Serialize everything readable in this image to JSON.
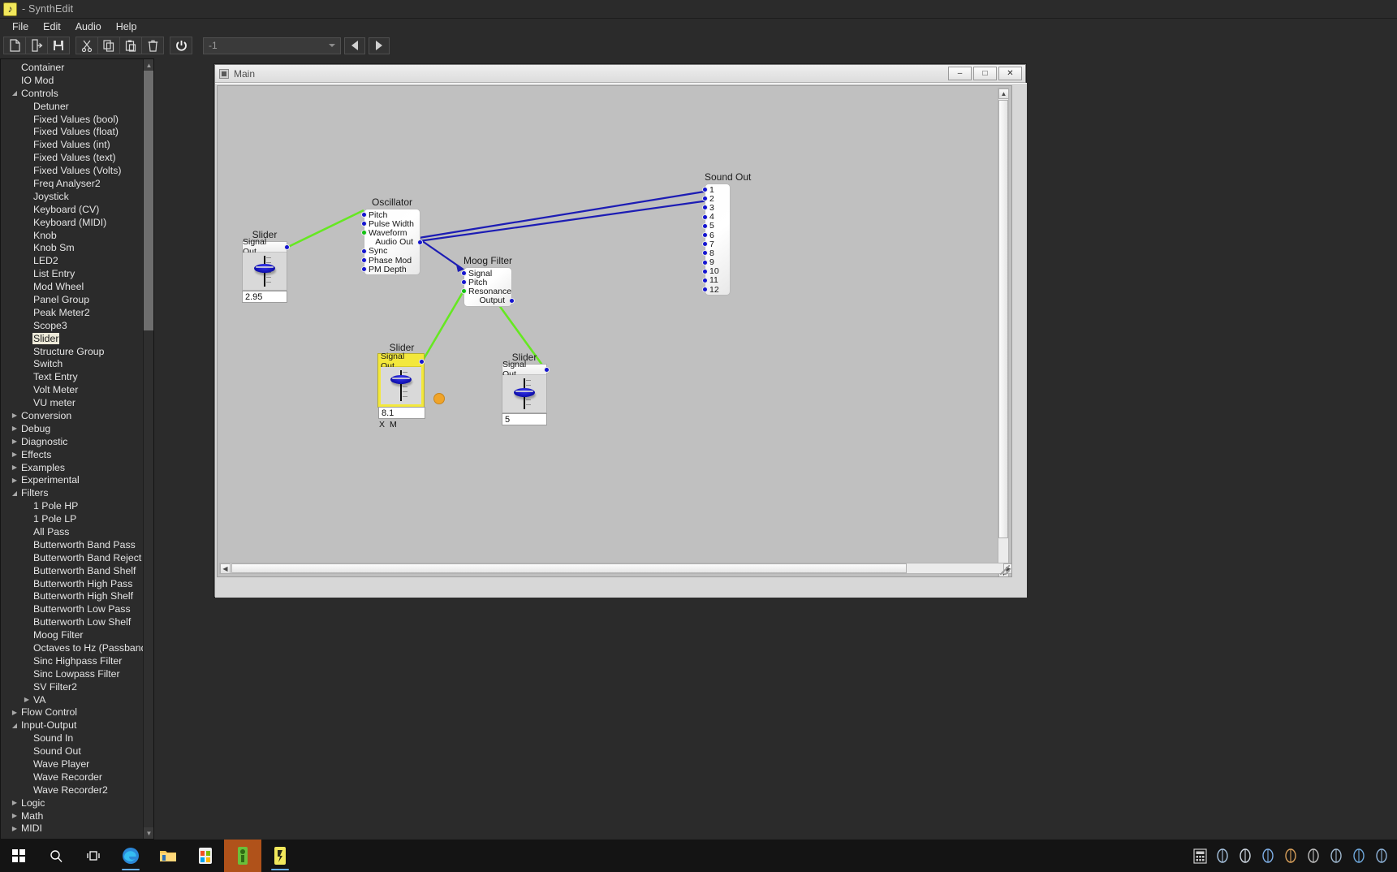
{
  "window": {
    "title": "- SynthEdit",
    "app_icon": "synthedit-icon"
  },
  "menu": {
    "items": [
      {
        "label": "File"
      },
      {
        "label": "Edit"
      },
      {
        "label": "Audio"
      },
      {
        "label": "Help"
      }
    ]
  },
  "toolbar": {
    "buttons": [
      {
        "name": "new-file-button",
        "icon": "page-icon"
      },
      {
        "name": "open-file-button",
        "icon": "open-folder-icon"
      },
      {
        "name": "save-file-button",
        "icon": "floppy-disk-icon"
      },
      {
        "name": "cut-button",
        "icon": "scissors-icon"
      },
      {
        "name": "copy-button",
        "icon": "copy-icon"
      },
      {
        "name": "paste-button",
        "icon": "clipboard-icon"
      },
      {
        "name": "delete-button",
        "icon": "trash-icon"
      },
      {
        "name": "power-button",
        "icon": "power-icon"
      }
    ],
    "preset_combo_value": "-1",
    "prev_label": "◀",
    "next_label": "▶"
  },
  "sidebar": {
    "items": [
      {
        "label": "Container",
        "depth": 0,
        "arrow": "none"
      },
      {
        "label": "IO Mod",
        "depth": 0,
        "arrow": "none"
      },
      {
        "label": "Controls",
        "depth": 0,
        "arrow": "expanded"
      },
      {
        "label": "Detuner",
        "depth": 1,
        "arrow": "none"
      },
      {
        "label": "Fixed Values (bool)",
        "depth": 1,
        "arrow": "none"
      },
      {
        "label": "Fixed Values (float)",
        "depth": 1,
        "arrow": "none"
      },
      {
        "label": "Fixed Values (int)",
        "depth": 1,
        "arrow": "none"
      },
      {
        "label": "Fixed Values (text)",
        "depth": 1,
        "arrow": "none"
      },
      {
        "label": "Fixed Values (Volts)",
        "depth": 1,
        "arrow": "none"
      },
      {
        "label": "Freq Analyser2",
        "depth": 1,
        "arrow": "none"
      },
      {
        "label": "Joystick",
        "depth": 1,
        "arrow": "none"
      },
      {
        "label": "Keyboard (CV)",
        "depth": 1,
        "arrow": "none"
      },
      {
        "label": "Keyboard (MIDI)",
        "depth": 1,
        "arrow": "none"
      },
      {
        "label": "Knob",
        "depth": 1,
        "arrow": "none"
      },
      {
        "label": "Knob Sm",
        "depth": 1,
        "arrow": "none"
      },
      {
        "label": "LED2",
        "depth": 1,
        "arrow": "none"
      },
      {
        "label": "List Entry",
        "depth": 1,
        "arrow": "none"
      },
      {
        "label": "Mod Wheel",
        "depth": 1,
        "arrow": "none"
      },
      {
        "label": "Panel Group",
        "depth": 1,
        "arrow": "none"
      },
      {
        "label": "Peak Meter2",
        "depth": 1,
        "arrow": "none"
      },
      {
        "label": "Scope3",
        "depth": 1,
        "arrow": "none"
      },
      {
        "label": "Slider",
        "depth": 1,
        "arrow": "none",
        "selected": true
      },
      {
        "label": "Structure Group",
        "depth": 1,
        "arrow": "none"
      },
      {
        "label": "Switch",
        "depth": 1,
        "arrow": "none"
      },
      {
        "label": "Text Entry",
        "depth": 1,
        "arrow": "none"
      },
      {
        "label": "Volt Meter",
        "depth": 1,
        "arrow": "none"
      },
      {
        "label": "VU meter",
        "depth": 1,
        "arrow": "none"
      },
      {
        "label": "Conversion",
        "depth": 0,
        "arrow": "collapsed"
      },
      {
        "label": "Debug",
        "depth": 0,
        "arrow": "collapsed"
      },
      {
        "label": "Diagnostic",
        "depth": 0,
        "arrow": "collapsed"
      },
      {
        "label": "Effects",
        "depth": 0,
        "arrow": "collapsed"
      },
      {
        "label": "Examples",
        "depth": 0,
        "arrow": "collapsed"
      },
      {
        "label": "Experimental",
        "depth": 0,
        "arrow": "collapsed"
      },
      {
        "label": "Filters",
        "depth": 0,
        "arrow": "expanded"
      },
      {
        "label": "1 Pole HP",
        "depth": 1,
        "arrow": "none"
      },
      {
        "label": "1 Pole LP",
        "depth": 1,
        "arrow": "none"
      },
      {
        "label": "All Pass",
        "depth": 1,
        "arrow": "none"
      },
      {
        "label": "Butterworth Band Pass",
        "depth": 1,
        "arrow": "none"
      },
      {
        "label": "Butterworth Band Reject",
        "depth": 1,
        "arrow": "none"
      },
      {
        "label": "Butterworth Band Shelf",
        "depth": 1,
        "arrow": "none"
      },
      {
        "label": "Butterworth High Pass",
        "depth": 1,
        "arrow": "none"
      },
      {
        "label": "Butterworth High Shelf",
        "depth": 1,
        "arrow": "none"
      },
      {
        "label": "Butterworth Low Pass",
        "depth": 1,
        "arrow": "none"
      },
      {
        "label": "Butterworth Low Shelf",
        "depth": 1,
        "arrow": "none"
      },
      {
        "label": "Moog Filter",
        "depth": 1,
        "arrow": "none"
      },
      {
        "label": "Octaves to Hz (Passband)",
        "depth": 1,
        "arrow": "none"
      },
      {
        "label": "Sinc Highpass Filter",
        "depth": 1,
        "arrow": "none"
      },
      {
        "label": "Sinc Lowpass Filter",
        "depth": 1,
        "arrow": "none"
      },
      {
        "label": "SV Filter2",
        "depth": 1,
        "arrow": "none"
      },
      {
        "label": "VA",
        "depth": 1,
        "arrow": "collapsed"
      },
      {
        "label": "Flow Control",
        "depth": 0,
        "arrow": "collapsed"
      },
      {
        "label": "Input-Output",
        "depth": 0,
        "arrow": "expanded"
      },
      {
        "label": "Sound In",
        "depth": 1,
        "arrow": "none"
      },
      {
        "label": "Sound Out",
        "depth": 1,
        "arrow": "none"
      },
      {
        "label": "Wave Player",
        "depth": 1,
        "arrow": "none"
      },
      {
        "label": "Wave Recorder",
        "depth": 1,
        "arrow": "none"
      },
      {
        "label": "Wave Recorder2",
        "depth": 1,
        "arrow": "none"
      },
      {
        "label": "Logic",
        "depth": 0,
        "arrow": "collapsed"
      },
      {
        "label": "Math",
        "depth": 0,
        "arrow": "collapsed"
      },
      {
        "label": "MIDI",
        "depth": 0,
        "arrow": "collapsed"
      }
    ]
  },
  "mdi": {
    "title": "Main",
    "minimize_label": "–",
    "maximize_label": "□",
    "close_label": "✕"
  },
  "patch": {
    "modules": [
      {
        "name": "oscillator",
        "title": "Oscillator",
        "inputs": [
          "Pitch",
          "Pulse Width",
          "Waveform"
        ],
        "inputs2": [
          "Sync",
          "Phase Mod",
          "PM Depth"
        ],
        "outputs": [
          "Audio Out"
        ],
        "green_ports": [
          "Waveform"
        ]
      },
      {
        "name": "moog-filter",
        "title": "Moog Filter",
        "inputs": [
          "Signal",
          "Pitch",
          "Resonance"
        ],
        "outputs": [
          "Output"
        ],
        "green_ports": [
          "Resonance"
        ]
      },
      {
        "name": "sound-out",
        "title": "Sound Out",
        "channels": [
          "1",
          "2",
          "3",
          "4",
          "5",
          "6",
          "7",
          "8",
          "9",
          "10",
          "11",
          "12"
        ]
      }
    ],
    "sliders": [
      {
        "name": "slider-pitch",
        "title": "Slider",
        "port_label": "Signal Out",
        "value": "2.95",
        "selected": false,
        "markers": []
      },
      {
        "name": "slider-cutoff",
        "title": "Slider",
        "port_label": "Signal Out",
        "value": "8.1",
        "selected": true,
        "markers": [
          "X",
          "M"
        ]
      },
      {
        "name": "slider-resonance",
        "title": "Slider",
        "port_label": "Signal Out",
        "value": "5",
        "selected": false,
        "markers": []
      }
    ],
    "colors": {
      "audio_wire": "#1c1cb4",
      "cv_wire": "#66e822",
      "selection": "#f3e83c",
      "port_blue": "#1414d0",
      "port_green": "#12c212",
      "canvas_bg": "#c0c0c0"
    }
  },
  "taskbar": {
    "items": [
      {
        "name": "start-button",
        "icon": "windows-logo-icon"
      },
      {
        "name": "search-button",
        "icon": "search-icon"
      },
      {
        "name": "task-view-button",
        "icon": "task-view-icon"
      },
      {
        "name": "edge-button",
        "icon": "edge-browser-icon"
      },
      {
        "name": "file-explorer-button",
        "icon": "folder-icon"
      },
      {
        "name": "store-button",
        "icon": "microsoft-store-icon"
      },
      {
        "name": "app-green-button",
        "icon": "app-icon"
      },
      {
        "name": "synthedit-taskbar-button",
        "icon": "synthedit-icon"
      }
    ],
    "tray": [
      {
        "name": "tray-calculator-icon",
        "icon": "calculator-icon"
      },
      {
        "name": "tray-icon-1",
        "icon": "circle-icon"
      },
      {
        "name": "tray-icon-2",
        "icon": "circle-icon"
      },
      {
        "name": "tray-icon-3",
        "icon": "circle-icon"
      },
      {
        "name": "tray-icon-4",
        "icon": "circle-icon"
      },
      {
        "name": "tray-icon-5",
        "icon": "circle-icon"
      },
      {
        "name": "tray-icon-6",
        "icon": "circle-icon"
      },
      {
        "name": "tray-icon-7",
        "icon": "circle-icon"
      },
      {
        "name": "tray-icon-8",
        "icon": "circle-icon"
      }
    ]
  }
}
